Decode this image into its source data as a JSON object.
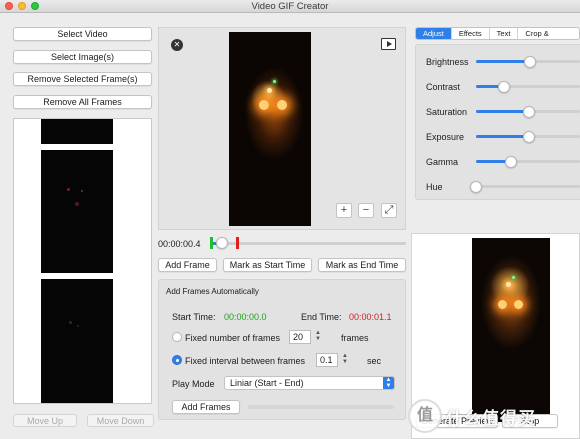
{
  "window": {
    "title": "Video GIF Creator"
  },
  "left": {
    "select_video": "Select Video",
    "select_images": "Select Image(s)",
    "remove_selected": "Remove Selected Frame(s)",
    "remove_all": "Remove All Frames",
    "move_up": "Move Up",
    "move_down": "Move Down"
  },
  "player": {
    "close_icon": "close-circle-icon",
    "play_icon": "play-icon",
    "zoom_in": "+",
    "zoom_out": "−",
    "fit": "⤢"
  },
  "timeline": {
    "current_time": "00:00:00.4",
    "progress": 0.02,
    "start_marker_color": "#1fbf2f",
    "end_marker_color": "#e02020"
  },
  "actions": {
    "add_frame": "Add Frame",
    "mark_start": "Mark as Start Time",
    "mark_end": "Mark as End Time"
  },
  "auto": {
    "heading": "Add Frames Automatically",
    "start_label": "Start Time:",
    "start_value": "00:00:00.0",
    "end_label": "End Time:",
    "end_value": "00:00:01.1",
    "fixed_number_label": "Fixed number of frames",
    "fixed_number_value": "20",
    "frames_unit": "frames",
    "fixed_interval_label": "Fixed interval between frames",
    "fixed_interval_value": "0.1",
    "sec_unit": "sec",
    "play_mode_label": "Play Mode",
    "play_mode_value": "Liniar (Start - End)",
    "add_frames_button": "Add Frames",
    "colors": {
      "start": "#1fa31f",
      "end": "#d42020"
    }
  },
  "tabs": [
    {
      "label": "Adjust",
      "active": true
    },
    {
      "label": "Effects",
      "active": false
    },
    {
      "label": "Text",
      "active": false
    },
    {
      "label": "Crop & Resize",
      "active": false
    }
  ],
  "adjust": {
    "items": [
      {
        "label": "Brightness",
        "value": 0.52
      },
      {
        "label": "Contrast",
        "value": 0.27
      },
      {
        "label": "Saturation",
        "value": 0.51
      },
      {
        "label": "Exposure",
        "value": 0.51
      },
      {
        "label": "Gamma",
        "value": 0.34
      },
      {
        "label": "Hue",
        "value": 0.0
      }
    ]
  },
  "preview": {
    "generate_preview": "Generate Preview",
    "stop": "Stop"
  },
  "watermark": {
    "text": "什么值得买",
    "badge": "值"
  },
  "colors": {
    "accent": "#2f7fe8"
  }
}
